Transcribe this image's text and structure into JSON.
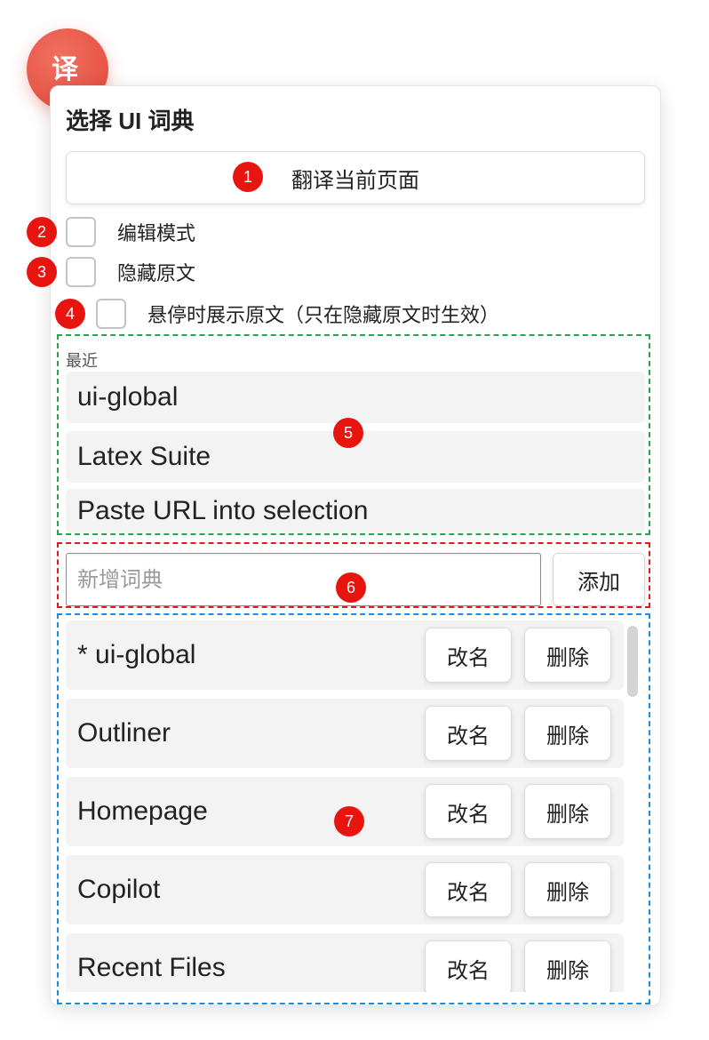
{
  "fab": {
    "label": "译"
  },
  "panel": {
    "title": "选择 UI 词典",
    "translate_button": "翻译当前页面",
    "options": [
      {
        "label": "编辑模式",
        "checked": false
      },
      {
        "label": "隐藏原文",
        "checked": false
      },
      {
        "label": "悬停时展示原文（只在隐藏原文时生效）",
        "checked": false
      }
    ],
    "recent": {
      "heading": "最近",
      "items": [
        "ui-global",
        "Latex Suite",
        "Paste URL into selection"
      ]
    },
    "new_dict": {
      "placeholder": "新增词典",
      "value": "",
      "add_label": "添加"
    },
    "dictionaries": {
      "rename_label": "改名",
      "delete_label": "删除",
      "items": [
        "* ui-global",
        "Outliner",
        "Homepage",
        "Copilot",
        "Recent Files"
      ]
    }
  },
  "markers": [
    "1",
    "2",
    "3",
    "4",
    "5",
    "6",
    "7"
  ],
  "colors": {
    "fab": "#e2493c",
    "marker": "#e8140f",
    "box_green": "#2aa34a",
    "box_red": "#e01b1b",
    "box_blue": "#1d8ae6",
    "row_bg": "#f3f3f3"
  }
}
